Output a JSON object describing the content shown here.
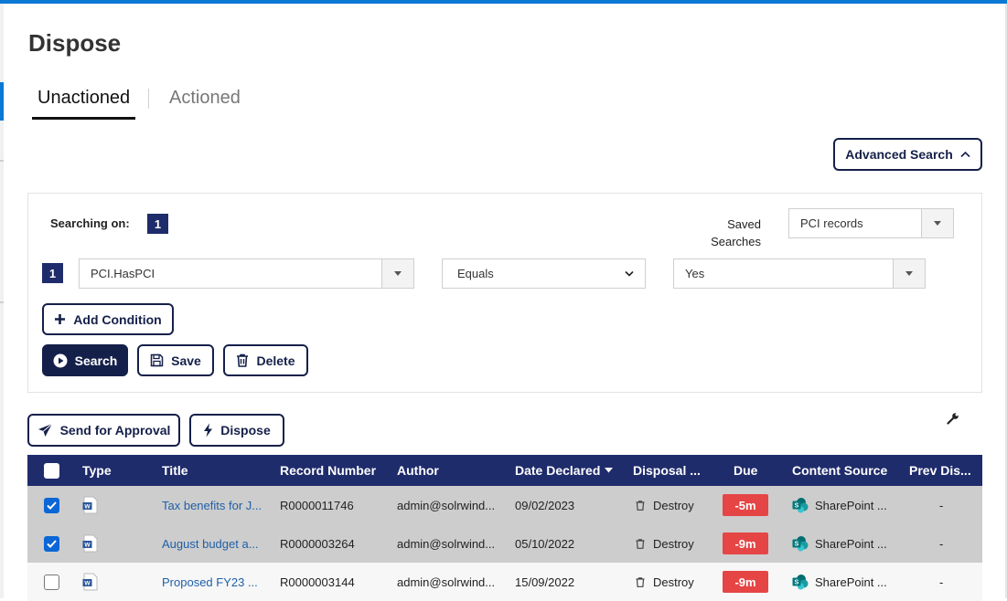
{
  "page": {
    "title": "Dispose"
  },
  "tabs": [
    {
      "label": "Unactioned",
      "active": true
    },
    {
      "label": "Actioned",
      "active": false
    }
  ],
  "advanced_search": {
    "label": "Advanced Search",
    "icon": "chevron-up-icon"
  },
  "search_panel": {
    "searching_on_label": "Searching on:",
    "condition_count": "1",
    "saved_searches_label": "Saved Searches",
    "saved_search_value": "PCI records",
    "conditions": [
      {
        "index": "1",
        "field": "PCI.HasPCI",
        "operator": "Equals",
        "value": "Yes"
      }
    ],
    "add_condition_label": "Add Condition",
    "search_label": "Search",
    "save_label": "Save",
    "delete_label": "Delete"
  },
  "actions": {
    "send_for_approval_label": "Send for Approval",
    "dispose_label": "Dispose"
  },
  "grid": {
    "columns": [
      "Type",
      "Title",
      "Record Number",
      "Author",
      "Date Declared",
      "Disposal ...",
      "Due",
      "Content Source",
      "Prev Dis..."
    ],
    "sort_column": "Date Declared",
    "rows": [
      {
        "selected": true,
        "type_icon": "word-doc-icon",
        "title": "Tax benefits for J...",
        "record_number": "R0000011746",
        "author": "admin@solrwind...",
        "date_declared": "09/02/2023",
        "disposal": "Destroy",
        "due": "-5m",
        "content_source": "SharePoint ...",
        "prev_disposal": "-"
      },
      {
        "selected": true,
        "type_icon": "word-doc-icon",
        "title": "August budget a...",
        "record_number": "R0000003264",
        "author": "admin@solrwind...",
        "date_declared": "05/10/2022",
        "disposal": "Destroy",
        "due": "-9m",
        "content_source": "SharePoint ...",
        "prev_disposal": "-"
      },
      {
        "selected": false,
        "type_icon": "word-doc-icon",
        "title": "Proposed FY23 ...",
        "record_number": "R0000003144",
        "author": "admin@solrwind...",
        "date_declared": "15/09/2022",
        "disposal": "Destroy",
        "due": "-9m",
        "content_source": "SharePoint ...",
        "prev_disposal": "-"
      }
    ]
  },
  "colors": {
    "navy": "#1f2c6b",
    "button_border": "#15204a",
    "accent_blue": "#0b78d4",
    "due_red": "#e64545",
    "link_blue": "#1f5fa8"
  }
}
